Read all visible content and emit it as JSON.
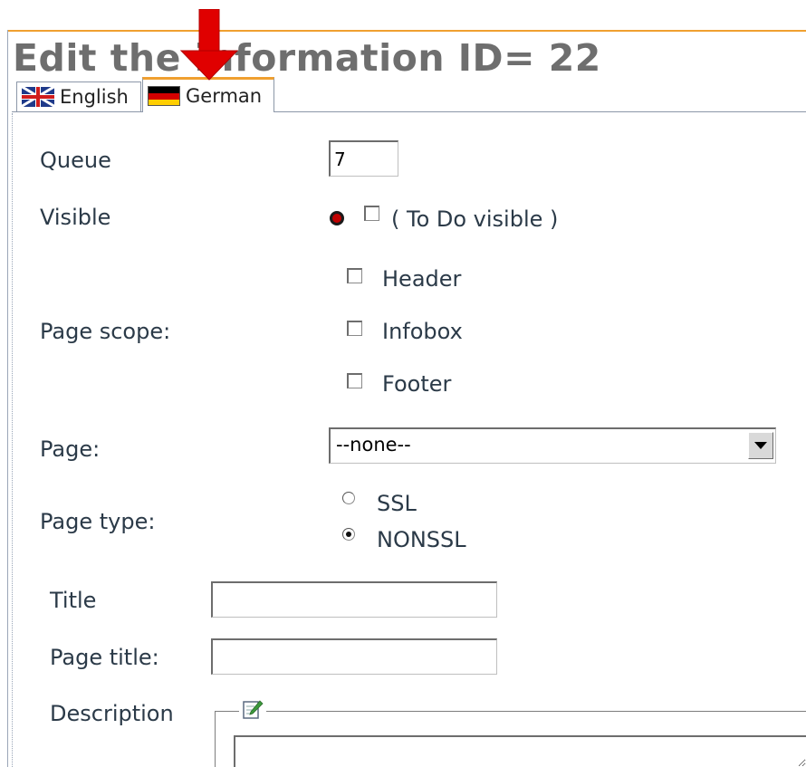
{
  "header": {
    "title": "Edit the information ID= 22"
  },
  "tabs": [
    {
      "label": "English",
      "flag_icon": "uk-flag-icon",
      "active": false
    },
    {
      "label": "German",
      "flag_icon": "german-flag-icon",
      "active": true
    }
  ],
  "form": {
    "queue": {
      "label": "Queue",
      "value": "7"
    },
    "visible": {
      "label": "Visible",
      "option_label": "( To Do visible )",
      "checked": false
    },
    "page_scope": {
      "label": "Page scope:",
      "options": [
        {
          "label": "Header",
          "checked": false
        },
        {
          "label": "Infobox",
          "checked": false
        },
        {
          "label": "Footer",
          "checked": false
        }
      ]
    },
    "page": {
      "label": "Page:",
      "selected": "--none--"
    },
    "page_type": {
      "label": "Page type:",
      "options": [
        {
          "label": "SSL",
          "checked": false
        },
        {
          "label": "NONSSL",
          "checked": true
        }
      ]
    },
    "title": {
      "label": "Title",
      "value": ""
    },
    "page_title": {
      "label": "Page title:",
      "value": ""
    },
    "description": {
      "label": "Description",
      "value": ""
    }
  },
  "colors": {
    "accent": "#f0a030",
    "arrow": "#e00000",
    "label_text": "#2b3a48"
  }
}
